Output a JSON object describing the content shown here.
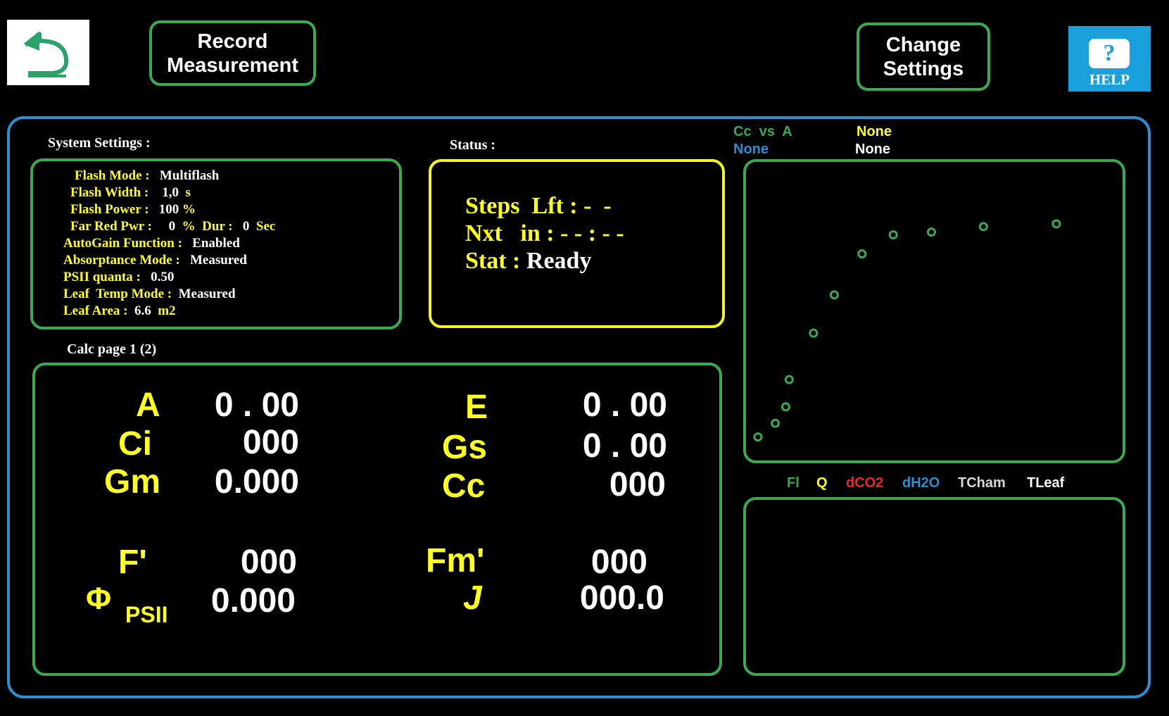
{
  "toolbar": {
    "back_icon": "undo-arrow-icon",
    "record_line1": "Record",
    "record_line2": "Measurement",
    "change_line1": "Change",
    "change_line2": "Settings",
    "help_icon_glyph": "?",
    "help_label": "HELP"
  },
  "system_settings": {
    "title": "System Settings :",
    "rows": [
      {
        "label": "Flash Mode :",
        "value": "Multiflash"
      },
      {
        "label": "Flash Width :",
        "value": "1,0",
        "unit": "s"
      },
      {
        "label": "Flash Power :",
        "value": "100",
        "unit": "%"
      },
      {
        "label": "Far Red Pwr :",
        "value": "0",
        "unit": "%",
        "label2": "Dur :",
        "value2": "0",
        "unit2": "Sec"
      },
      {
        "label": "AutoGain Function :",
        "value": "Enabled"
      },
      {
        "label": "Absorptance Mode :",
        "value": "Measured"
      },
      {
        "label": "PSII quanta :",
        "value": "0.50"
      },
      {
        "label": "Leaf  Temp Mode :",
        "value": "Measured"
      },
      {
        "label": "Leaf Area :",
        "value": "6.6",
        "unit": "m2"
      }
    ]
  },
  "status": {
    "title": "Status :",
    "steps_label": "Steps  Lft :",
    "steps_value": "-  -",
    "next_label": "Nxt   in :",
    "next_value": "- - : - -",
    "stat_label": "Stat :",
    "stat_value": "Ready"
  },
  "calc": {
    "page_label": "Calc page  1 (2)",
    "left": [
      {
        "label": "A",
        "value": "0 . 00"
      },
      {
        "label": "Ci",
        "value": "000"
      },
      {
        "label": "Gm",
        "value": "0.000"
      },
      {
        "label": "F'",
        "value": "000"
      },
      {
        "label": "Φ",
        "sub": "PSII",
        "value": "0.000"
      }
    ],
    "right": [
      {
        "label": "E",
        "value": "0 . 00"
      },
      {
        "label": "Gs",
        "value": "0 . 00"
      },
      {
        "label": "Cc",
        "value": "000"
      },
      {
        "label": "Fm'",
        "value": "000"
      },
      {
        "label": "J",
        "value": "000.0"
      }
    ]
  },
  "plot_header": {
    "title_green": "Cc  vs  A",
    "title_yellow": "None",
    "title_blue": "None",
    "title_white": "None"
  },
  "chart_data": {
    "type": "scatter",
    "title": "Cc  vs  A",
    "xlabel": "",
    "ylabel": "",
    "grid": false,
    "series": [
      {
        "name": "Cc  vs  A",
        "color": "#3aaa4f",
        "x": [
          1,
          6,
          9,
          10,
          17,
          23,
          31,
          40,
          51,
          66,
          87
        ],
        "y": [
          5,
          10,
          16,
          26,
          43,
          57,
          72,
          79,
          80,
          82,
          83
        ]
      }
    ],
    "xlim": [
      0,
      100
    ],
    "ylim": [
      0,
      100
    ]
  },
  "trace_legend": [
    {
      "label": "Fl",
      "color": "#3aaa4f"
    },
    {
      "label": "Q",
      "color": "#ffff1e"
    },
    {
      "label": "dCO2",
      "color": "#e8282a"
    },
    {
      "label": "dH2O",
      "color": "#2b8fd1"
    },
    {
      "label": "TCham",
      "color": "#d8d8d8"
    },
    {
      "label": "TLeaf",
      "color": "#ffffff"
    }
  ],
  "colors": {
    "accent_green": "#3aaa4f",
    "frame_blue": "#2b8fd1",
    "label_yellow": "#ffff1e",
    "status_yellow": "#f5f51e",
    "help_blue": "#1aa0dc"
  }
}
